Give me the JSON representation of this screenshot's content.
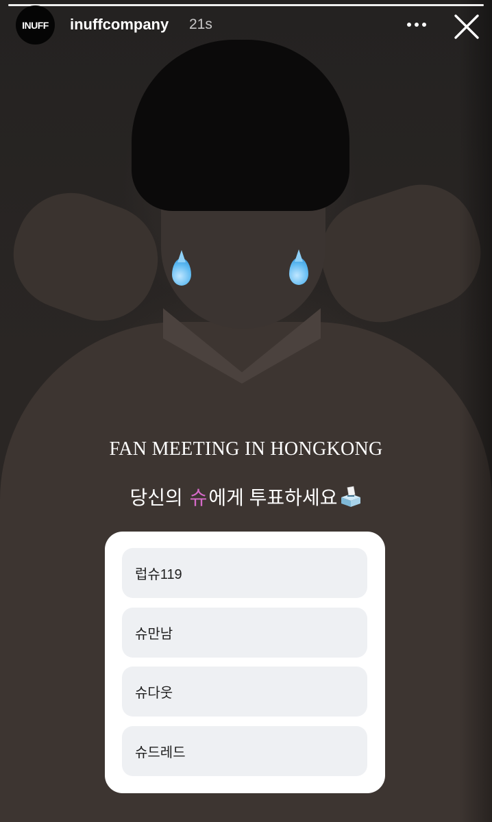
{
  "story": {
    "username": "inuffcompany",
    "time": "21s",
    "avatar_text": "INUFF",
    "progress_fraction": 1.0
  },
  "icons": {
    "more": "more-horizontal-icon",
    "close": "close-icon",
    "droplet": "droplet-emoji",
    "ballot": "ballot-box-emoji"
  },
  "caption": {
    "title": "FAN MEETING IN HONGKONG",
    "subtitle_before": "당신의 ",
    "subtitle_accent": "슈",
    "subtitle_after": "에게 투표하세요"
  },
  "colors": {
    "accent": "#d66ac9",
    "poll_background": "#ffffff",
    "option_background": "#eef0f3"
  },
  "poll": {
    "options": [
      {
        "label": "럽슈119"
      },
      {
        "label": "슈만남"
      },
      {
        "label": "슈다웃"
      },
      {
        "label": "슈드레드"
      }
    ]
  }
}
